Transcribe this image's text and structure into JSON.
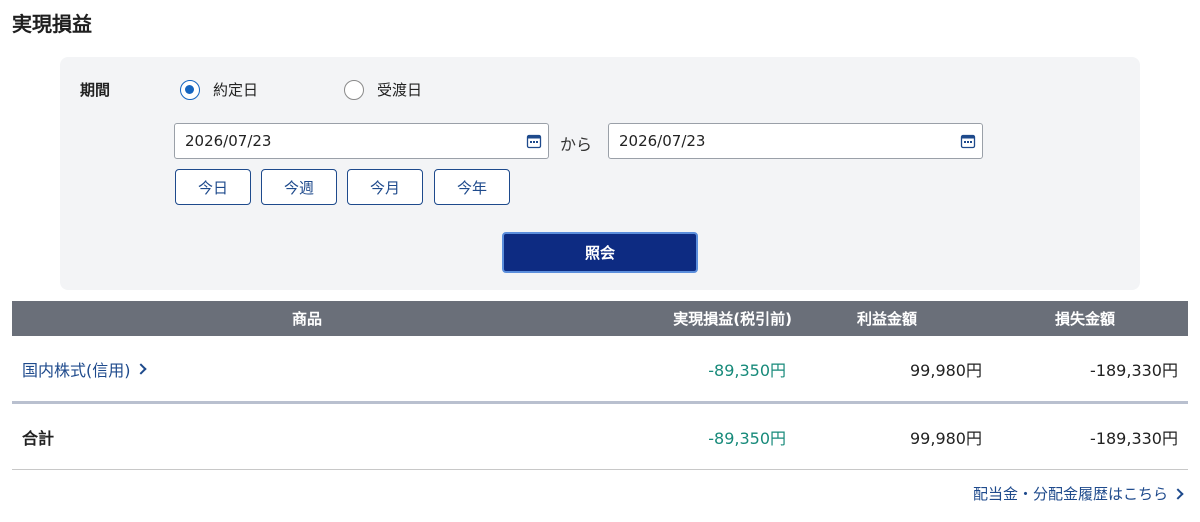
{
  "page": {
    "title": "実現損益"
  },
  "filter": {
    "period_label": "期間",
    "radio_options": [
      {
        "label": "約定日",
        "selected": true
      },
      {
        "label": "受渡日",
        "selected": false
      }
    ],
    "date_from": "2026/07/23",
    "date_to": "2026/07/23",
    "range_separator": "から",
    "quick_buttons": [
      "今日",
      "今週",
      "今月",
      "今年"
    ],
    "submit_label": "照会",
    "colors": {
      "accent": "#1565c0",
      "submit_bg": "#0d2b82",
      "panel_bg": "#f3f4f6"
    }
  },
  "table": {
    "headers": {
      "product": "商品",
      "realized": "実現損益(税引前)",
      "profit": "利益金額",
      "loss": "損失金額"
    },
    "rows": [
      {
        "product": "国内株式(信用)",
        "realized": "-89,350円",
        "profit": "99,980円",
        "loss": "-189,330円"
      }
    ],
    "total": {
      "label": "合計",
      "realized": "-89,350円",
      "profit": "99,980円",
      "loss": "-189,330円"
    },
    "colors": {
      "header_bg": "#6a6f79",
      "negative_text": "#178a7a",
      "link": "#1e4a8c"
    }
  },
  "footer": {
    "dividend_link": "配当金・分配金履歴はこちら"
  },
  "icons": {
    "calendar": "calendar-icon",
    "chevron": "chevron-right-icon"
  }
}
